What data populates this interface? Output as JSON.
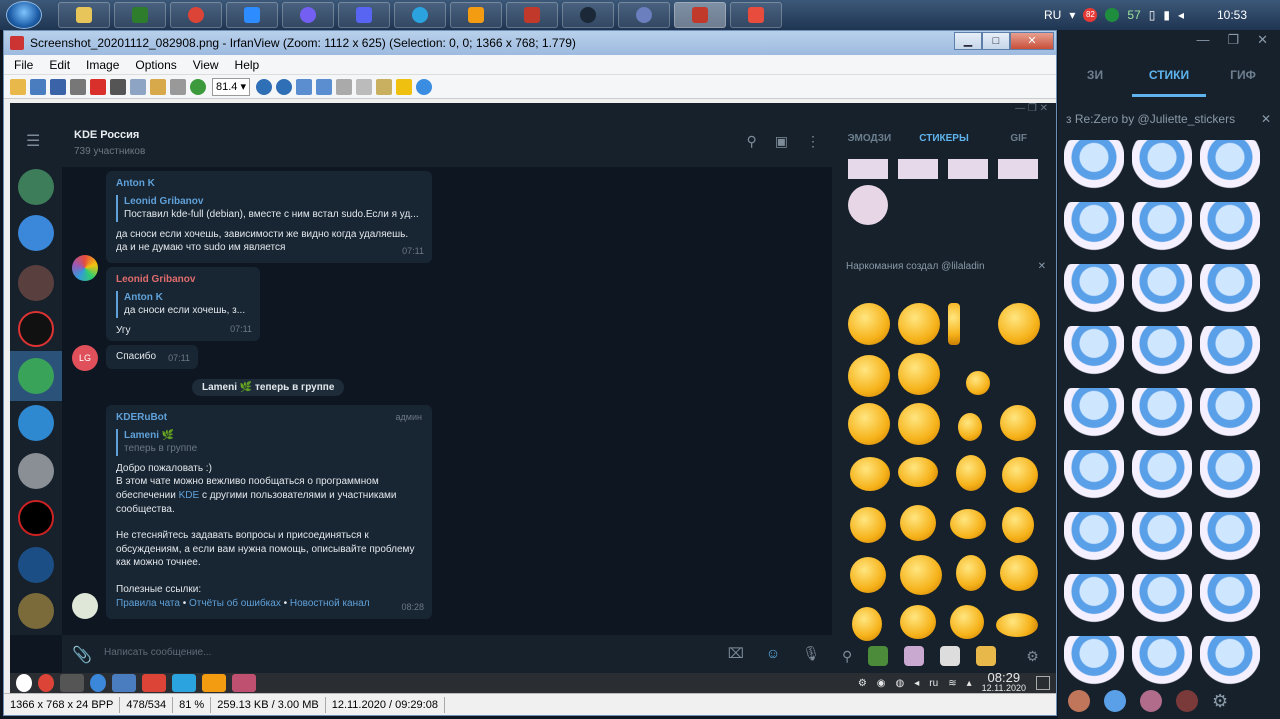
{
  "taskbar": {
    "tray_lang": "RU",
    "badge_a": "82",
    "badge_b": "57",
    "clock": "10:53"
  },
  "bg_telegram": {
    "tabs": [
      "ЗИ",
      "СТИКИ",
      "ГИФ"
    ],
    "set_title": "з Re:Zero by @Juliette_stickers",
    "close": "✕"
  },
  "irfanview": {
    "title": "Screenshot_20201112_082908.png - IrfanView (Zoom: 1112 x 625) (Selection: 0, 0; 1366 x 768; 1.779)",
    "menu": [
      "File",
      "Edit",
      "Image",
      "Options",
      "View",
      "Help"
    ],
    "zoom_value": "81.4",
    "status": [
      "1366 x 768 x 24 BPP",
      "478/534",
      "81 %",
      "259.13 KB / 3.00 MB",
      "12.11.2020 / 09:29:08"
    ]
  },
  "chat": {
    "title": "KDE Россия",
    "subtitle": "739 участников",
    "messages": {
      "m1": {
        "name": "Anton K",
        "reply_name": "Leonid Gribanov",
        "reply_text": "Поставил kde-full (debian), вместе с ним встал sudo.Если я уд...",
        "text": "да сноси если хочешь, зависимости же видно когда удаляешь.\nда и не думаю что sudo им является",
        "time": "07:11"
      },
      "m2": {
        "name": "Leonid Gribanov",
        "reply_name": "Anton K",
        "reply_text": "да сноси если хочешь, з...",
        "text": "Угу",
        "time": "07:11"
      },
      "m3": {
        "avatar": "LG",
        "text": "Спасибо",
        "time": "07:11"
      },
      "svc": "Lameni 🌿 теперь в группе",
      "m4": {
        "name": "KDERuBot",
        "role": "админ",
        "reply_name": "Lameni 🌿",
        "reply_text": "теперь в группе",
        "p1": "Добро пожаловать :)",
        "p2a": "В этом чате можно вежливо пообщаться о программном обеспечении ",
        "p2link": "KDE",
        "p2b": " с другими пользователями и участниками сообщества.",
        "p3": "Не стесняйтесь задавать вопросы и присоединяться к обсуждениям, а если вам нужна помощь, описывайте проблему как можно точнее.",
        "p4": "Полезные ссылки:",
        "l1": "Правила чата",
        "sep": " • ",
        "l2": "Отчёты об ошибках",
        "l3": "Новостной канал",
        "time": "08:28"
      }
    },
    "input_placeholder": "Написать сообщение..."
  },
  "sticker_panel": {
    "tabs": [
      "ЭМОДЗИ",
      "СТИКЕРЫ",
      "GIF"
    ],
    "set_title": "Наркомания создал @lilaladin",
    "close": "✕"
  },
  "kde_taskbar": {
    "lang": "ru",
    "time": "08:29",
    "date": "12.11.2020"
  },
  "colors": {
    "accent": "#5fb4ed",
    "bubble": "#182533",
    "bg": "#0e1621",
    "panel": "#17212b"
  }
}
